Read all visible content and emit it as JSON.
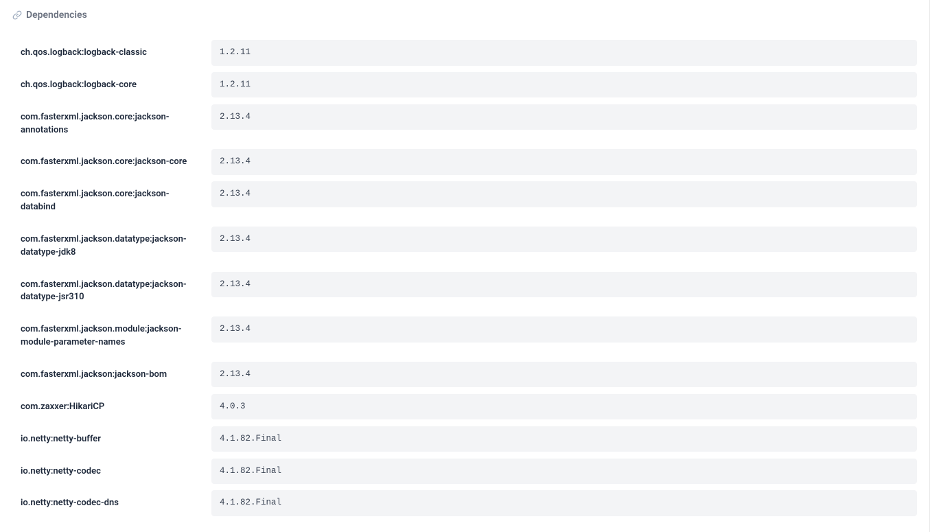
{
  "header": {
    "title": "Dependencies"
  },
  "dependencies": [
    {
      "name": "ch.qos.logback:logback-classic",
      "version": "1.2.11"
    },
    {
      "name": "ch.qos.logback:logback-core",
      "version": "1.2.11"
    },
    {
      "name": "com.fasterxml.jackson.core:jackson-annotations",
      "version": "2.13.4"
    },
    {
      "name": "com.fasterxml.jackson.core:jackson-core",
      "version": "2.13.4"
    },
    {
      "name": "com.fasterxml.jackson.core:jackson-databind",
      "version": "2.13.4"
    },
    {
      "name": "com.fasterxml.jackson.datatype:jackson-datatype-jdk8",
      "version": "2.13.4"
    },
    {
      "name": "com.fasterxml.jackson.datatype:jackson-datatype-jsr310",
      "version": "2.13.4"
    },
    {
      "name": "com.fasterxml.jackson.module:jackson-module-parameter-names",
      "version": "2.13.4"
    },
    {
      "name": "com.fasterxml.jackson:jackson-bom",
      "version": "2.13.4"
    },
    {
      "name": "com.zaxxer:HikariCP",
      "version": "4.0.3"
    },
    {
      "name": "io.netty:netty-buffer",
      "version": "4.1.82.Final"
    },
    {
      "name": "io.netty:netty-codec",
      "version": "4.1.82.Final"
    },
    {
      "name": "io.netty:netty-codec-dns",
      "version": "4.1.82.Final"
    }
  ]
}
